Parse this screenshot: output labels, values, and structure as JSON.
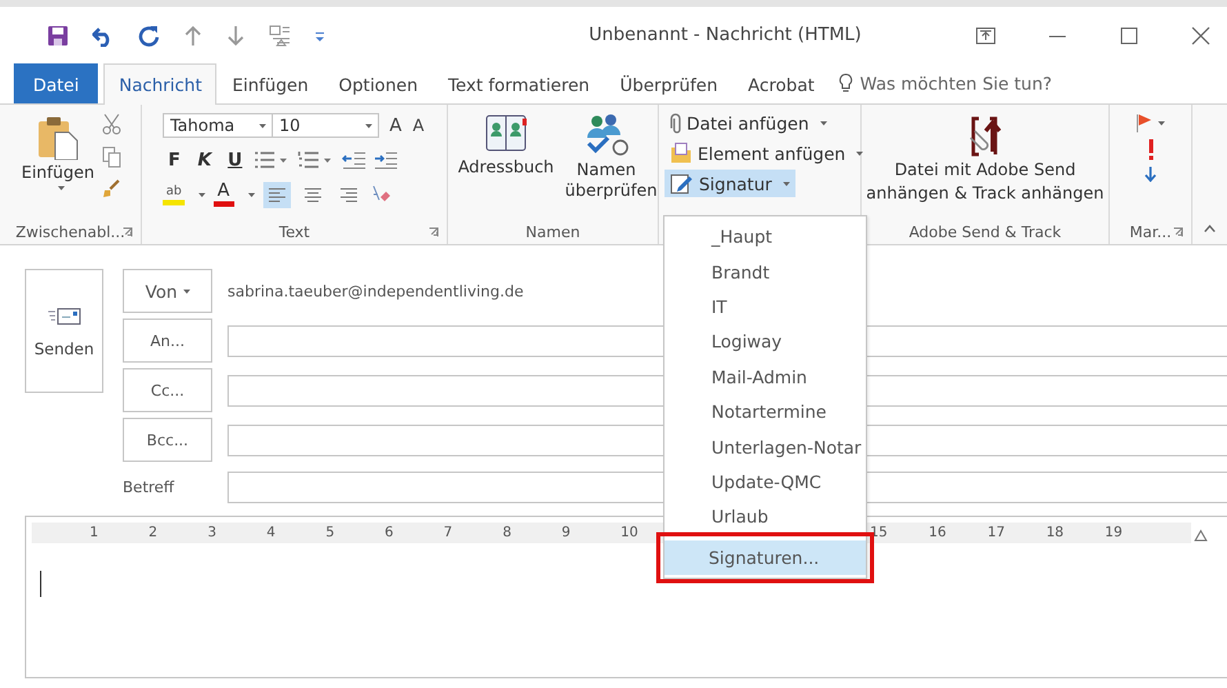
{
  "window": {
    "title": "Unbenannt - Nachricht (HTML)"
  },
  "tabs": [
    {
      "label": "Datei",
      "kind": "file",
      "selected": false
    },
    {
      "label": "Nachricht",
      "kind": "tab",
      "selected": true
    },
    {
      "label": "Einfügen",
      "kind": "tab",
      "selected": false
    },
    {
      "label": "Optionen",
      "kind": "tab",
      "selected": false
    },
    {
      "label": "Text formatieren",
      "kind": "tab",
      "selected": false
    },
    {
      "label": "Überprüfen",
      "kind": "tab",
      "selected": false
    },
    {
      "label": "Acrobat",
      "kind": "tab",
      "selected": false
    }
  ],
  "tell_me": {
    "placeholder": "Was möchten Sie tun?"
  },
  "ribbon": {
    "clipboard": {
      "paste_label": "Einfügen",
      "group_label": "Zwischenabl..."
    },
    "text": {
      "font": "Tahoma",
      "size": "10",
      "grow": "A",
      "shrink": "A",
      "styles": [
        "F",
        "K",
        "U"
      ],
      "highlight": "ab",
      "font_color": "A",
      "align": [
        {
          "kind": "left",
          "selected": true
        },
        {
          "kind": "center",
          "selected": false
        },
        {
          "kind": "right",
          "selected": false
        }
      ],
      "group_label": "Text"
    },
    "names": {
      "address_book": "Adressbuch",
      "check_names": "Namen überprüfen",
      "group_label": "Namen"
    },
    "include": [
      {
        "label": "Datei anfügen",
        "kind": "attach",
        "expanded": false
      },
      {
        "label": "Element anfügen",
        "kind": "item",
        "expanded": false
      },
      {
        "label": "Signatur",
        "kind": "signature",
        "expanded": true
      }
    ],
    "adobe": {
      "label_1": "Datei mit Adobe Send",
      "label_2": "anhängen & Track anhängen",
      "group_label": "Adobe Send & Track"
    },
    "tags": {
      "group_label": "Mar..."
    }
  },
  "compose": {
    "send": "Senden",
    "from_button": "Von",
    "from_value": "sabrina.taeuber@independentliving.de",
    "recipients": [
      {
        "label": "An..."
      },
      {
        "label": "Cc..."
      },
      {
        "label": "Bcc..."
      }
    ],
    "subject_label": "Betreff"
  },
  "ruler": {
    "left_numbers": [
      "1",
      "2",
      "3",
      "4",
      "5",
      "6",
      "7",
      "8",
      "9",
      "10"
    ],
    "right_numbers": [
      "15",
      "16",
      "17",
      "18",
      "19"
    ]
  },
  "signature_menu": {
    "items": [
      {
        "label": "_Haupt",
        "kind": "signature",
        "selected": false
      },
      {
        "label": "Brandt",
        "kind": "signature",
        "selected": false
      },
      {
        "label": "IT",
        "kind": "signature",
        "selected": false
      },
      {
        "label": "Logiway",
        "kind": "signature",
        "selected": false
      },
      {
        "label": "Mail-Admin",
        "kind": "signature",
        "selected": false
      },
      {
        "label": "Notartermine",
        "kind": "signature",
        "selected": false
      },
      {
        "label": "Unterlagen-Notar",
        "kind": "signature",
        "selected": false
      },
      {
        "label": "Update-QMC",
        "kind": "signature",
        "selected": false
      },
      {
        "label": "Urlaub",
        "kind": "signature",
        "selected": false
      },
      {
        "label": "Signaturen...",
        "kind": "command",
        "selected": true,
        "outlined": true
      }
    ]
  }
}
